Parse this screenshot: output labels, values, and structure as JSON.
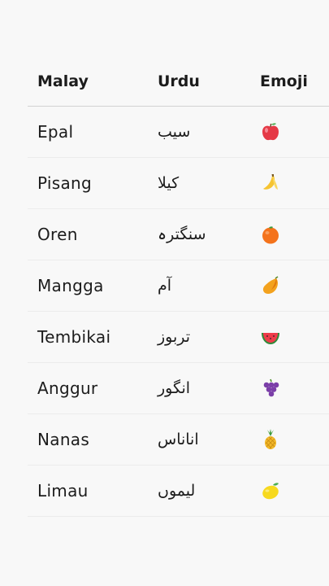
{
  "table": {
    "headers": {
      "malay": "Malay",
      "urdu": "Urdu",
      "emoji": "Emoji"
    },
    "rows": [
      {
        "malay": "Epal",
        "urdu": "سیب",
        "emoji": "apple-icon"
      },
      {
        "malay": "Pisang",
        "urdu": "کیلا",
        "emoji": "banana-icon"
      },
      {
        "malay": "Oren",
        "urdu": "سنگترہ",
        "emoji": "orange-icon"
      },
      {
        "malay": "Mangga",
        "urdu": "آم",
        "emoji": "mango-icon"
      },
      {
        "malay": "Tembikai",
        "urdu": "تربوز",
        "emoji": "watermelon-icon"
      },
      {
        "malay": "Anggur",
        "urdu": "انگور",
        "emoji": "grapes-icon"
      },
      {
        "malay": "Nanas",
        "urdu": "اناناس",
        "emoji": "pineapple-icon"
      },
      {
        "malay": "Limau",
        "urdu": "لیموں",
        "emoji": "lemon-icon"
      }
    ]
  },
  "colors": {
    "background": "#f8f8f8",
    "text": "#1c1c1c",
    "divider": "#ececec"
  }
}
